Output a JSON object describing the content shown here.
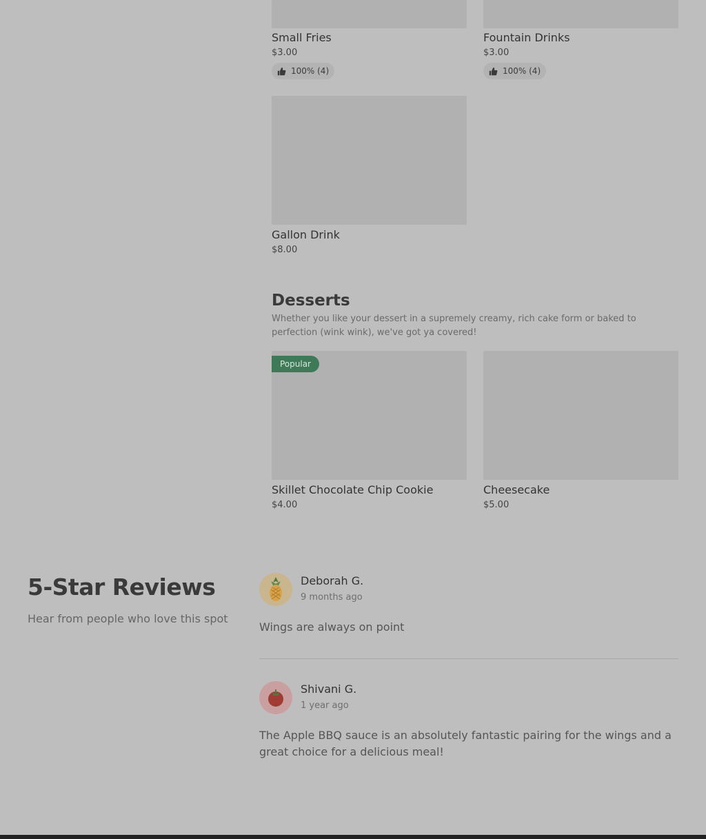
{
  "drinks": {
    "items": [
      {
        "name": "Small Fries",
        "price": "$3.00",
        "rating": "100% (4)"
      },
      {
        "name": "Fountain Drinks",
        "price": "$3.00",
        "rating": "100% (4)"
      },
      {
        "name": "Gallon Drink",
        "price": "$8.00"
      }
    ]
  },
  "desserts": {
    "title": "Desserts",
    "description": "Whether you like your dessert in a supremely creamy, rich cake form or baked to perfection (wink wink), we've got ya covered!",
    "items": [
      {
        "name": "Skillet Chocolate Chip Cookie",
        "price": "$4.00",
        "badge": "Popular"
      },
      {
        "name": "Cheesecake",
        "price": "$5.00"
      }
    ]
  },
  "reviews": {
    "title": "5-Star Reviews",
    "subtitle": "Hear from people who love this spot",
    "list": [
      {
        "name": "Deborah G.",
        "time": "9 months ago",
        "text": "Wings are always on point",
        "avatar_icon": "pineapple-icon"
      },
      {
        "name": "Shivani G.",
        "time": "1 year ago",
        "text": "The Apple BBQ sauce is an absolutely fantastic pairing for the wings and a great choice for a delicious meal!",
        "avatar_icon": "tomato-icon"
      }
    ]
  },
  "colors": {
    "background": "#bebebe",
    "image_placeholder": "#b1b1b1",
    "popular_badge": "#3e7a58"
  }
}
